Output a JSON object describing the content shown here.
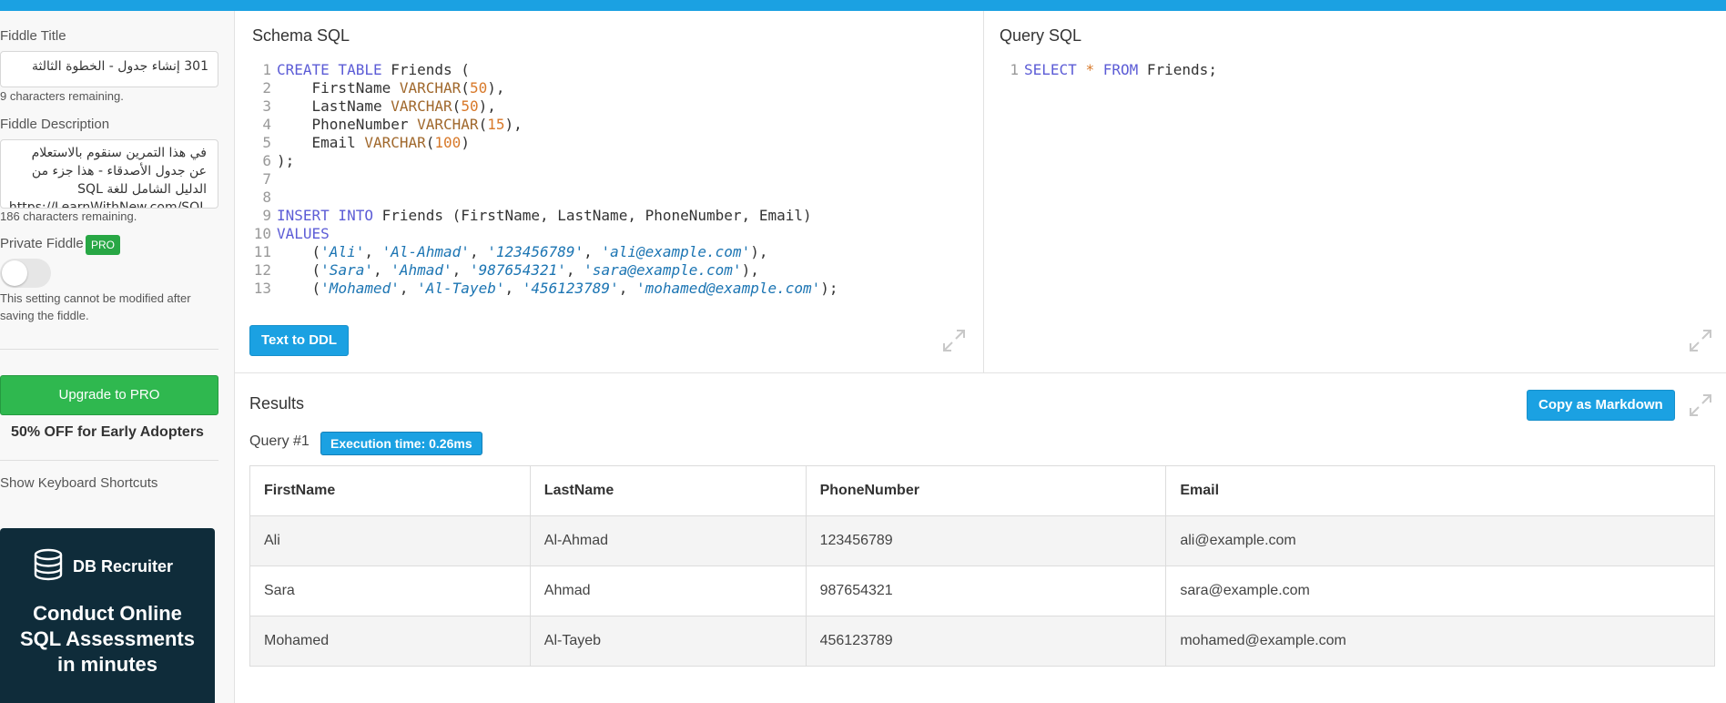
{
  "sidebar": {
    "fiddle_title_label": "Fiddle Title",
    "fiddle_title_value": "301 إنشاء جدول - الخطوة الثالثة",
    "title_remaining": "9 characters remaining.",
    "fiddle_description_label": "Fiddle Description",
    "description_lines": [
      "في هذا التمرين سنقوم بالاستعلام",
      "عن جدول الأصدقاء - هذا جزء من",
      "الدليل الشامل للغة SQL",
      "https://LearnWithNew.com/SQL"
    ],
    "description_remaining": "186 characters remaining.",
    "private_fiddle_label": "Private Fiddle",
    "pro_badge": "PRO",
    "private_toggle_on": false,
    "private_note": "This setting cannot be modified after saving the fiddle.",
    "upgrade_label": "Upgrade to PRO",
    "discount_text": "50% OFF for Early Adopters",
    "shortcuts_label": "Show Keyboard Shortcuts",
    "promo": {
      "brand": "DB Recruiter",
      "headline_lines": [
        "Conduct Online",
        "SQL Assessments",
        "in minutes"
      ]
    }
  },
  "schema": {
    "title": "Schema SQL",
    "text_to_ddl_label": "Text to DDL",
    "lines": [
      {
        "n": "1",
        "tokens": [
          [
            "kw",
            "CREATE TABLE"
          ],
          [
            "plain",
            " Friends ("
          ]
        ]
      },
      {
        "n": "2",
        "tokens": [
          [
            "plain",
            "    FirstName "
          ],
          [
            "ty",
            "VARCHAR"
          ],
          [
            "plain",
            "("
          ],
          [
            "num",
            "50"
          ],
          [
            "plain",
            "),"
          ]
        ]
      },
      {
        "n": "3",
        "tokens": [
          [
            "plain",
            "    LastName "
          ],
          [
            "ty",
            "VARCHAR"
          ],
          [
            "plain",
            "("
          ],
          [
            "num",
            "50"
          ],
          [
            "plain",
            "),"
          ]
        ]
      },
      {
        "n": "4",
        "tokens": [
          [
            "plain",
            "    PhoneNumber "
          ],
          [
            "ty",
            "VARCHAR"
          ],
          [
            "plain",
            "("
          ],
          [
            "num",
            "15"
          ],
          [
            "plain",
            "),"
          ]
        ]
      },
      {
        "n": "5",
        "tokens": [
          [
            "plain",
            "    Email "
          ],
          [
            "ty",
            "VARCHAR"
          ],
          [
            "plain",
            "("
          ],
          [
            "num",
            "100"
          ],
          [
            "plain",
            ")"
          ]
        ]
      },
      {
        "n": "6",
        "tokens": [
          [
            "plain",
            ");"
          ]
        ]
      },
      {
        "n": "7",
        "tokens": []
      },
      {
        "n": "8",
        "tokens": []
      },
      {
        "n": "9",
        "tokens": [
          [
            "kw",
            "INSERT INTO"
          ],
          [
            "plain",
            " Friends (FirstName, LastName, PhoneNumber, Email)"
          ]
        ]
      },
      {
        "n": "10",
        "tokens": [
          [
            "kw",
            "VALUES"
          ]
        ]
      },
      {
        "n": "11",
        "tokens": [
          [
            "plain",
            "    ("
          ],
          [
            "str",
            "'Ali'"
          ],
          [
            "plain",
            ", "
          ],
          [
            "str",
            "'Al-Ahmad'"
          ],
          [
            "plain",
            ", "
          ],
          [
            "str",
            "'123456789'"
          ],
          [
            "plain",
            ", "
          ],
          [
            "str",
            "'ali@example.com'"
          ],
          [
            "plain",
            "),"
          ]
        ]
      },
      {
        "n": "12",
        "tokens": [
          [
            "plain",
            "    ("
          ],
          [
            "str",
            "'Sara'"
          ],
          [
            "plain",
            ", "
          ],
          [
            "str",
            "'Ahmad'"
          ],
          [
            "plain",
            ", "
          ],
          [
            "str",
            "'987654321'"
          ],
          [
            "plain",
            ", "
          ],
          [
            "str",
            "'sara@example.com'"
          ],
          [
            "plain",
            "),"
          ]
        ]
      },
      {
        "n": "13",
        "tokens": [
          [
            "plain",
            "    ("
          ],
          [
            "str",
            "'Mohamed'"
          ],
          [
            "plain",
            ", "
          ],
          [
            "str",
            "'Al-Tayeb'"
          ],
          [
            "plain",
            ", "
          ],
          [
            "str",
            "'456123789'"
          ],
          [
            "plain",
            ", "
          ],
          [
            "str",
            "'mohamed@example.com'"
          ],
          [
            "plain",
            ");"
          ]
        ]
      }
    ]
  },
  "query": {
    "title": "Query SQL",
    "lines": [
      {
        "n": "1",
        "tokens": [
          [
            "kw",
            "SELECT"
          ],
          [
            "plain",
            " "
          ],
          [
            "num",
            "*"
          ],
          [
            "plain",
            " "
          ],
          [
            "kw",
            "FROM"
          ],
          [
            "plain",
            " Friends;"
          ]
        ]
      }
    ]
  },
  "results": {
    "title": "Results",
    "copy_markdown_label": "Copy as Markdown",
    "query_label": "Query #1",
    "execution_time": "Execution time: 0.26ms",
    "columns": [
      "FirstName",
      "LastName",
      "PhoneNumber",
      "Email"
    ],
    "rows": [
      [
        "Ali",
        "Al-Ahmad",
        "123456789",
        "ali@example.com"
      ],
      [
        "Sara",
        "Ahmad",
        "987654321",
        "sara@example.com"
      ],
      [
        "Mohamed",
        "Al-Tayeb",
        "456123789",
        "mohamed@example.com"
      ]
    ]
  },
  "colors": {
    "accent": "#1ba1e2",
    "upgrade_green": "#2fb84f",
    "promo_bg": "#0f2c3a"
  }
}
